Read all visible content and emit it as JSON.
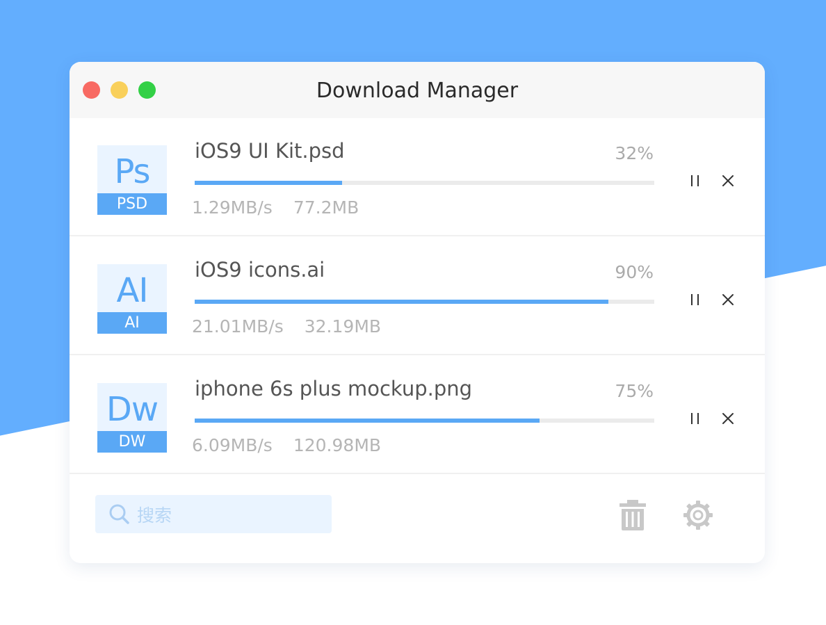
{
  "colors": {
    "background_accent": "#63aefe",
    "progress_fill": "#5aa8f5",
    "traffic_red": "#f86a63",
    "traffic_yellow": "#f9d05b",
    "traffic_green": "#33d046"
  },
  "window": {
    "title": "Download Manager"
  },
  "downloads": [
    {
      "icon_glyph": "Ps",
      "icon_tag": "PSD",
      "file_name": "iOS9 UI Kit.psd",
      "percent_text": "32%",
      "progress": 0.32,
      "speed": "1.29MB/s",
      "size": "77.2MB",
      "pause_icon": "pause-icon",
      "cancel_icon": "close-icon"
    },
    {
      "icon_glyph": "AI",
      "icon_tag": "AI",
      "file_name": "iOS9 icons.ai",
      "percent_text": "90%",
      "progress": 0.9,
      "speed": "21.01MB/s",
      "size": "32.19MB",
      "pause_icon": "pause-icon",
      "cancel_icon": "close-icon"
    },
    {
      "icon_glyph": "Dw",
      "icon_tag": "DW",
      "file_name": "iphone 6s plus mockup.png",
      "percent_text": "75%",
      "progress": 0.75,
      "speed": "6.09MB/s",
      "size": "120.98MB",
      "pause_icon": "pause-icon",
      "cancel_icon": "close-icon"
    }
  ],
  "footer": {
    "search_placeholder": "搜索",
    "search_value": "",
    "search_icon": "search-icon",
    "trash_icon": "trash-icon",
    "settings_icon": "gear-icon"
  }
}
